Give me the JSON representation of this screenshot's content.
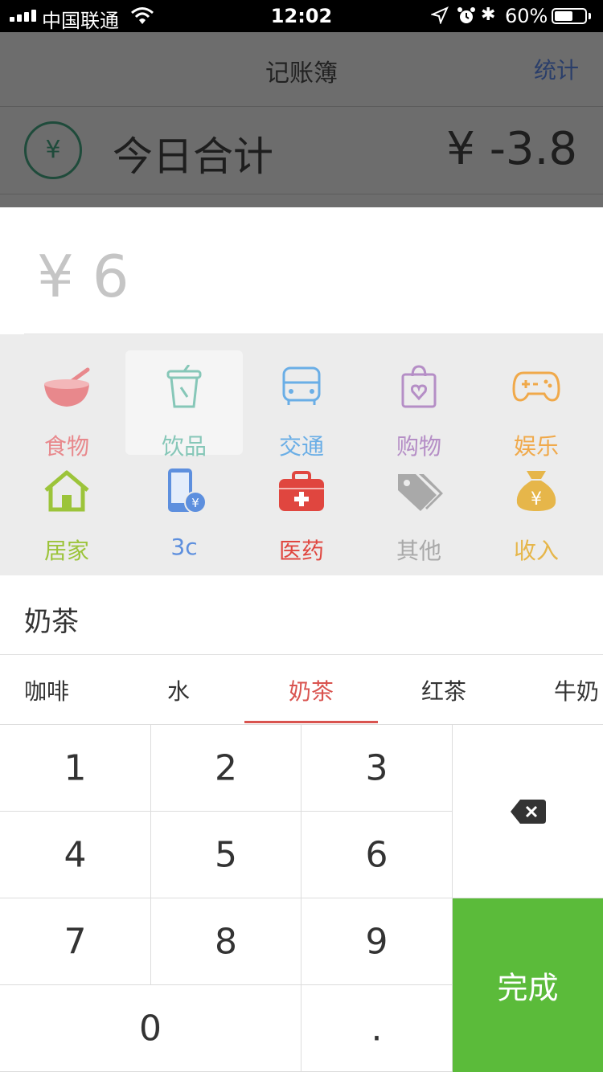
{
  "status_bar": {
    "carrier": "中国联通",
    "time": "12:02",
    "battery": "60%",
    "battery_level": 0.6
  },
  "header": {
    "title": "记账簿",
    "stats_label": "统计"
  },
  "summary": {
    "currency_symbol": "¥",
    "label": "今日合计",
    "amount": "¥ -3.8"
  },
  "entry": {
    "amount": "¥ 6"
  },
  "categories": [
    {
      "label": "食物",
      "icon": "bowl-icon",
      "color": "#e8888c"
    },
    {
      "label": "饮品",
      "icon": "cup-icon",
      "color": "#86c7b8",
      "selected": true
    },
    {
      "label": "交通",
      "icon": "bus-icon",
      "color": "#6aaee6"
    },
    {
      "label": "购物",
      "icon": "shopping-bag-icon",
      "color": "#b58ec6"
    },
    {
      "label": "娱乐",
      "icon": "gamepad-icon",
      "color": "#f0a94a"
    },
    {
      "label": "居家",
      "icon": "house-icon",
      "color": "#9cc43a"
    },
    {
      "label": "3c",
      "icon": "phone-icon",
      "color": "#5d8fde"
    },
    {
      "label": "医药",
      "icon": "medical-kit-icon",
      "color": "#e0463f"
    },
    {
      "label": "其他",
      "icon": "tag-icon",
      "color": "#a9a9a9"
    },
    {
      "label": "收入",
      "icon": "money-bag-icon",
      "color": "#e6b64a"
    }
  ],
  "note": {
    "text": "奶茶"
  },
  "suggestions": [
    "咖啡",
    "水",
    "奶茶",
    "红茶",
    "牛奶"
  ],
  "suggestion_active_index": 2,
  "keypad": {
    "keys": [
      "1",
      "2",
      "3",
      "4",
      "5",
      "6",
      "7",
      "8",
      "9",
      "0",
      "."
    ],
    "done_label": "完成"
  },
  "colors": {
    "accent_red": "#d9534f",
    "done_green": "#5bbb3a"
  }
}
